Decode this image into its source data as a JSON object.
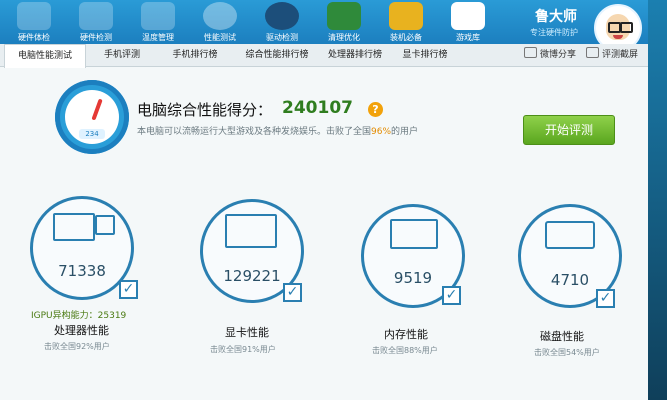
{
  "top_toolbar": [
    {
      "label": "硬件体检",
      "icon": "monitor-check-icon"
    },
    {
      "label": "硬件检测",
      "icon": "chip-icon"
    },
    {
      "label": "温度管理",
      "icon": "thermometer-icon"
    },
    {
      "label": "性能测试",
      "icon": "speedometer-icon"
    },
    {
      "label": "驱动检测",
      "icon": "gear-icon"
    },
    {
      "label": "清理优化",
      "icon": "broom-icon"
    },
    {
      "label": "装机必备",
      "icon": "cube-icon"
    },
    {
      "label": "游戏库",
      "icon": "gamepad-icon"
    }
  ],
  "brand": {
    "name": "鲁大师",
    "slogan": "专注硬件防护"
  },
  "tabs": [
    {
      "label": "电脑性能测试",
      "active": true
    },
    {
      "label": "手机评测"
    },
    {
      "label": "手机排行榜"
    },
    {
      "label": "综合性能排行榜"
    },
    {
      "label": "处理器排行榜"
    },
    {
      "label": "显卡排行榜"
    }
  ],
  "tab_actions": {
    "share": "微博分享",
    "screenshot": "评测截屏"
  },
  "gauge": {
    "readout": "234"
  },
  "summary": {
    "title": "电脑综合性能得分：",
    "score": "240107",
    "help": "?",
    "desc_prefix": "本电脑可以流畅运行大型游戏及各种发烧娱乐。击败了全国",
    "desc_pct": "96%",
    "desc_suffix": "的用户"
  },
  "start_button": "开始评测",
  "categories": [
    {
      "key": "cpu",
      "score": "71338",
      "label": "处理器性能",
      "sub": "击败全国92%用户"
    },
    {
      "key": "gpu",
      "score": "129221",
      "label": "显卡性能",
      "sub": "击败全国91%用户"
    },
    {
      "key": "mem",
      "score": "9519",
      "label": "内存性能",
      "sub": "击败全国88%用户"
    },
    {
      "key": "disk",
      "score": "4710",
      "label": "磁盘性能",
      "sub": "击败全国54%用户"
    }
  ],
  "igpu": "IGPU异构能力：25319",
  "check_mark": "✓"
}
